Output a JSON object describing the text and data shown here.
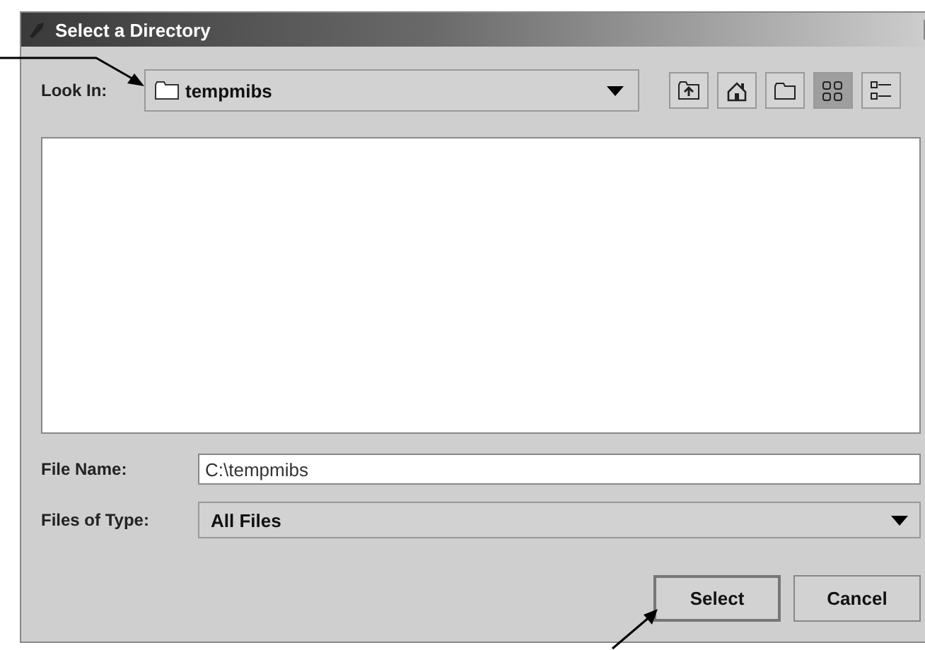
{
  "window": {
    "title": "Select a Directory"
  },
  "look_in": {
    "label": "Look In:",
    "value": "tempmibs"
  },
  "toolbar": [
    {
      "kind": "up"
    },
    {
      "kind": "home"
    },
    {
      "kind": "new-folder"
    },
    {
      "kind": "list",
      "selected": true
    },
    {
      "kind": "details",
      "selected": false
    }
  ],
  "file_name": {
    "label": "File Name:",
    "value": "C:\\tempmibs"
  },
  "files_of_type": {
    "label": "Files of Type:",
    "value": "All Files"
  },
  "buttons": [
    {
      "label": "Select",
      "kind": "default"
    },
    {
      "label": "Cancel",
      "kind": "normal"
    }
  ]
}
